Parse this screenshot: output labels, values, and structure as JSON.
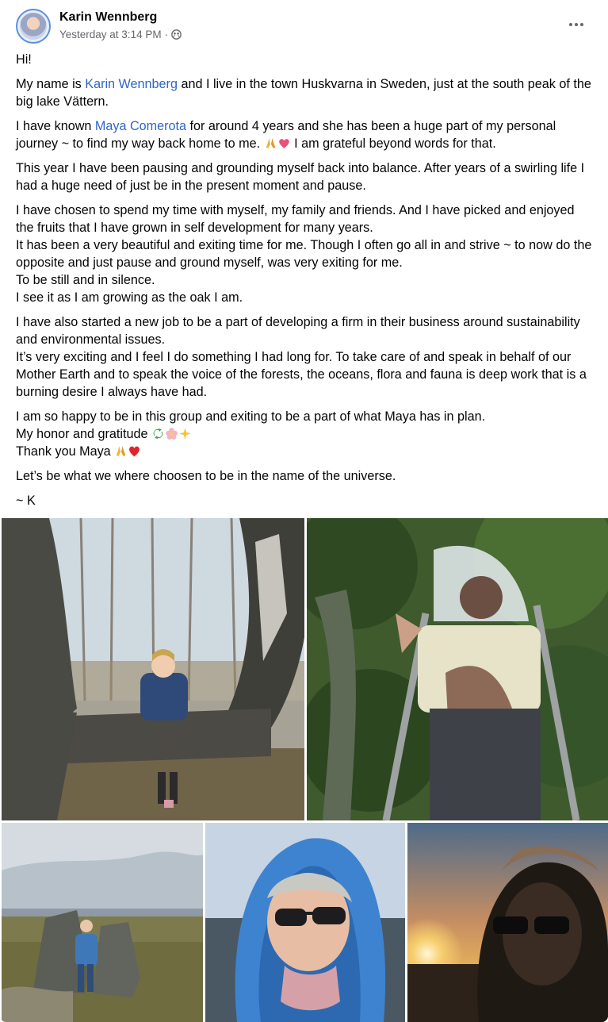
{
  "post": {
    "author": "Karin Wennberg",
    "timestamp": "Yesterday at 3:14 PM",
    "separator": "·",
    "audience_icon": "friends-icon",
    "more_icon": "more-options-icon"
  },
  "content": {
    "greeting": "Hi!",
    "p1_a": "My name is ",
    "p1_link": "Karin Wennberg",
    "p1_b": " and I live in the town Huskvarna in Sweden, just at the south peak of the big lake Vättern.",
    "p2_a": "I have known ",
    "p2_link": "Maya Comerota",
    "p2_b": " for around 4 years and she has been a huge part of my personal journey ~ to find my way back home to me.",
    "p2_c": " I am grateful beyond words for that.",
    "p3": "This year I have been pausing and grounding myself back into balance. After years of a swirling life I had a huge need of just be in the present moment and pause.",
    "p4_l1": "I have chosen to spend my time with myself, my family and friends. And I have picked and enjoyed the fruits that I have grown in self development for many years.",
    "p4_l2": "It has been a very beautiful and exiting time for me. Though I often go all in and strive ~ to now do the opposite and just pause and ground myself, was very exiting for me.",
    "p4_l3": "To be still and in silence.",
    "p4_l4": "I see it as I am growing as the oak I am.",
    "p5_l1": "I have also started a new job to be a part of developing a firm in their business around sustainability and environmental issues.",
    "p5_l2": "It’s very exciting and I feel I do something I had long for. To take care of and speak in behalf of our Mother Earth and to speak the voice of the forests, the oceans, flora and fauna is deep work that is a burning desire I always have had.",
    "p6_l1": "I am so happy to be in this group and exiting to be a part of what Maya has in plan.",
    "p6_l2": "My honor and gratitude ",
    "p6_l3": "Thank you Maya ",
    "p7": "Let’s be what we where choosen to be in the name of the universe.",
    "signoff": "~ K"
  },
  "photos": [
    {
      "name": "photo-woman-by-tree",
      "alt": ""
    },
    {
      "name": "photo-woman-on-ladder",
      "alt": ""
    },
    {
      "name": "photo-woman-by-rock",
      "alt": ""
    },
    {
      "name": "photo-woman-blue-hood",
      "alt": ""
    },
    {
      "name": "photo-sunset-selfie",
      "alt": ""
    }
  ],
  "colors": {
    "link": "#2f66c6",
    "secondary_text": "#65676b",
    "text": "#050505"
  }
}
